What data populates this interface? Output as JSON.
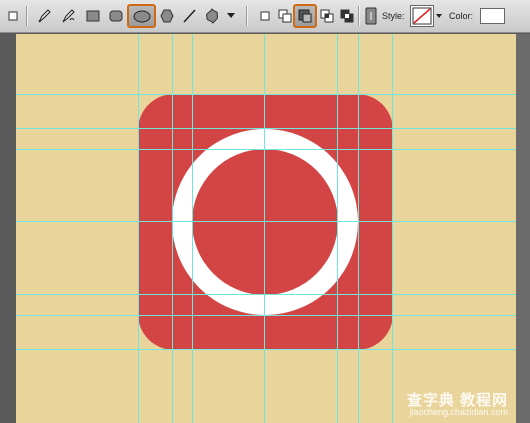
{
  "toolbar": {
    "style_label": "Style:",
    "color_label": "Color:",
    "tools": [
      "rectangle-marquee-icon",
      "pen-icon",
      "freeform-pen-icon",
      "rectangle-shape-icon",
      "rounded-rectangle-icon",
      "ellipse-icon",
      "polygon-icon",
      "line-icon",
      "custom-shape-icon"
    ],
    "selected_tool": "ellipse-icon",
    "selected_path_op": "subtract-icon",
    "fill_color": "#ffffff",
    "selected_border_color": "#d06a12"
  },
  "canvas": {
    "background_color": "#e9d59c",
    "icon_color": "#d34545",
    "ring_color": "#ffffff",
    "guide_color": "#6fe7df"
  },
  "watermark": {
    "main": "查字典 教程网",
    "sub": "jiaocheng.chazidian.com"
  }
}
